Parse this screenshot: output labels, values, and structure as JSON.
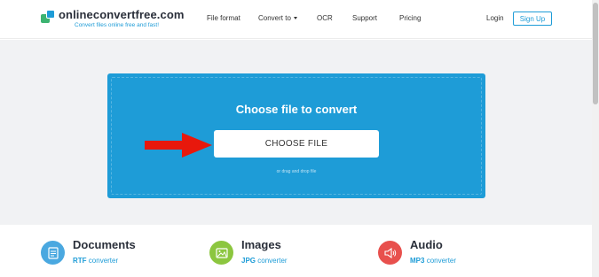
{
  "brand": {
    "name": "onlineconvertfree.com",
    "tagline": "Convert files online free and fast!"
  },
  "nav": {
    "items": [
      {
        "label": "File format"
      },
      {
        "label": "Convert to"
      },
      {
        "label": "OCR"
      },
      {
        "label": "Support"
      },
      {
        "label": "Pricing"
      }
    ],
    "login": "Login",
    "signup": "Sign Up"
  },
  "upload": {
    "title": "Choose file to convert",
    "button": "CHOOSE FILE",
    "hint": "or drag and drop file"
  },
  "categories": [
    {
      "title": "Documents",
      "format": "RTF",
      "suffix": "converter",
      "color": "#4aa8e0",
      "icon": "document-icon"
    },
    {
      "title": "Images",
      "format": "JPG",
      "suffix": "converter",
      "color": "#8cc63f",
      "icon": "image-icon"
    },
    {
      "title": "Audio",
      "format": "MP3",
      "suffix": "converter",
      "color": "#e8504d",
      "icon": "speaker-icon"
    }
  ],
  "colors": {
    "accent": "#1e9cd7",
    "arrow": "#e8180c"
  }
}
